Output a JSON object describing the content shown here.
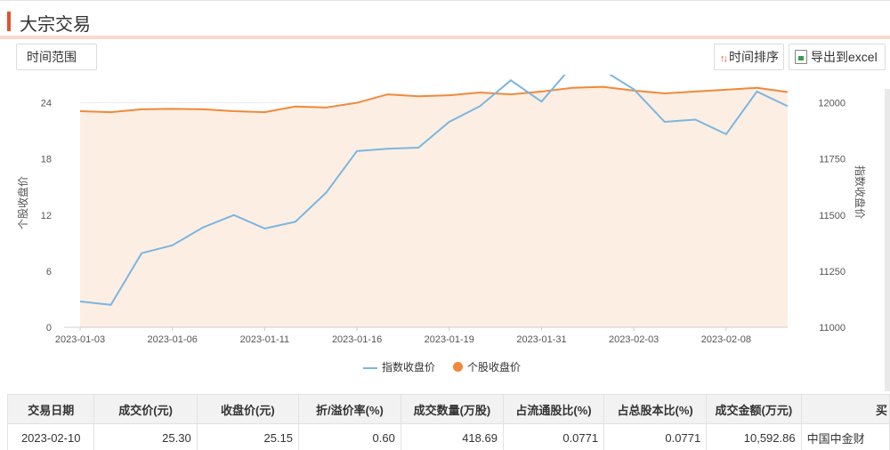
{
  "header": {
    "title": "大宗交易"
  },
  "toolbar": {
    "range_label": "时间范围",
    "sort_label": "时间排序",
    "export_label": "导出到excel"
  },
  "icons": {
    "sort": "sort-arrows-icon",
    "export": "excel-file-icon"
  },
  "colors": {
    "accent": "#e2532d",
    "index_series": "#7ab6e0",
    "stock_series": "#f0893a",
    "area_fill": "#fdeee3"
  },
  "chart_data": {
    "type": "line",
    "ylabel_left": "个股收盘价",
    "ylabel_right": "指数收盘价",
    "ylim_left": [
      0,
      27
    ],
    "ylim_right": [
      11000,
      12125
    ],
    "yticks_left": [
      "0",
      "6",
      "12",
      "18",
      "24"
    ],
    "yticks_right": [
      "11000",
      "11250",
      "11500",
      "11750",
      "12000"
    ],
    "x": [
      "2023-01-03",
      "2023-01-04",
      "2023-01-05",
      "2023-01-06",
      "2023-01-09",
      "2023-01-10",
      "2023-01-11",
      "2023-01-12",
      "2023-01-13",
      "2023-01-16",
      "2023-01-17",
      "2023-01-18",
      "2023-01-19",
      "2023-01-20",
      "2023-01-30",
      "2023-01-31",
      "2023-02-01",
      "2023-02-02",
      "2023-02-03",
      "2023-02-06",
      "2023-02-07",
      "2023-02-08",
      "2023-02-09",
      "2023-02-10"
    ],
    "xtick_labels": [
      "2023-01-03",
      "2023-01-06",
      "2023-01-11",
      "2023-01-16",
      "2023-01-19",
      "2023-01-31",
      "2023-02-03",
      "2023-02-08"
    ],
    "series": [
      {
        "name": "指数收盘价",
        "axis": "right",
        "values": [
          11115,
          11100,
          11330,
          11365,
          11445,
          11500,
          11440,
          11470,
          11600,
          11785,
          11795,
          11800,
          11915,
          11985,
          12100,
          12005,
          12165,
          12145,
          12060,
          11915,
          11925,
          11860,
          12050,
          11985
        ]
      },
      {
        "name": "个股收盘价",
        "axis": "left",
        "values": [
          23.1,
          23.0,
          23.3,
          23.35,
          23.3,
          23.1,
          23.0,
          23.6,
          23.5,
          24.0,
          24.9,
          24.7,
          24.8,
          25.1,
          24.9,
          25.2,
          25.6,
          25.7,
          25.3,
          25.0,
          25.2,
          25.4,
          25.6,
          25.15
        ]
      }
    ],
    "legend": [
      "指数收盘价",
      "个股收盘价"
    ],
    "legend_position": "bottom-center",
    "grid": true
  },
  "table": {
    "headers": [
      "交易日期",
      "成交价(元)",
      "收盘价(元)",
      "折/溢价率(%)",
      "成交数量(万股)",
      "占流通股比(%)",
      "占总股本比(%)",
      "成交金额(万元)",
      "买"
    ],
    "rows": [
      [
        "2023-02-10",
        "25.30",
        "25.15",
        "0.60",
        "418.69",
        "0.0771",
        "0.0771",
        "10,592.86",
        "中国中金财"
      ]
    ]
  }
}
